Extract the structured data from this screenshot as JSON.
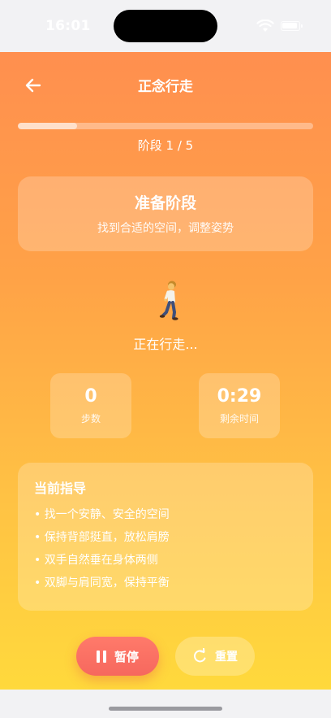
{
  "status_bar": {
    "time": "16:01"
  },
  "header": {
    "title": "正念行走",
    "back_icon": "arrow-left-icon"
  },
  "progress": {
    "current": 1,
    "total": 5,
    "fraction": 0.2,
    "label": "阶段 1 / 5"
  },
  "phase": {
    "title": "准备阶段",
    "subtitle": "找到合适的空间，调整姿势"
  },
  "activity": {
    "icon": "person-walking-icon",
    "status": "正在行走..."
  },
  "stats": {
    "steps": {
      "value": "0",
      "label": "步数"
    },
    "remaining": {
      "value": "0:29",
      "label": "剩余时间"
    }
  },
  "guide": {
    "title": "当前指导",
    "items": [
      "找一个安静、安全的空间",
      "保持背部挺直，放松肩膀",
      "双手自然垂在身体两侧",
      "双脚与肩同宽，保持平衡"
    ]
  },
  "controls": {
    "pause_label": "暂停",
    "pause_icon": "pause-icon",
    "reset_label": "重置",
    "reset_icon": "refresh-icon"
  },
  "colors": {
    "gradient_top": "#ff8f4f",
    "gradient_bottom": "#ffd93c",
    "pause_button": "#f6685e"
  }
}
